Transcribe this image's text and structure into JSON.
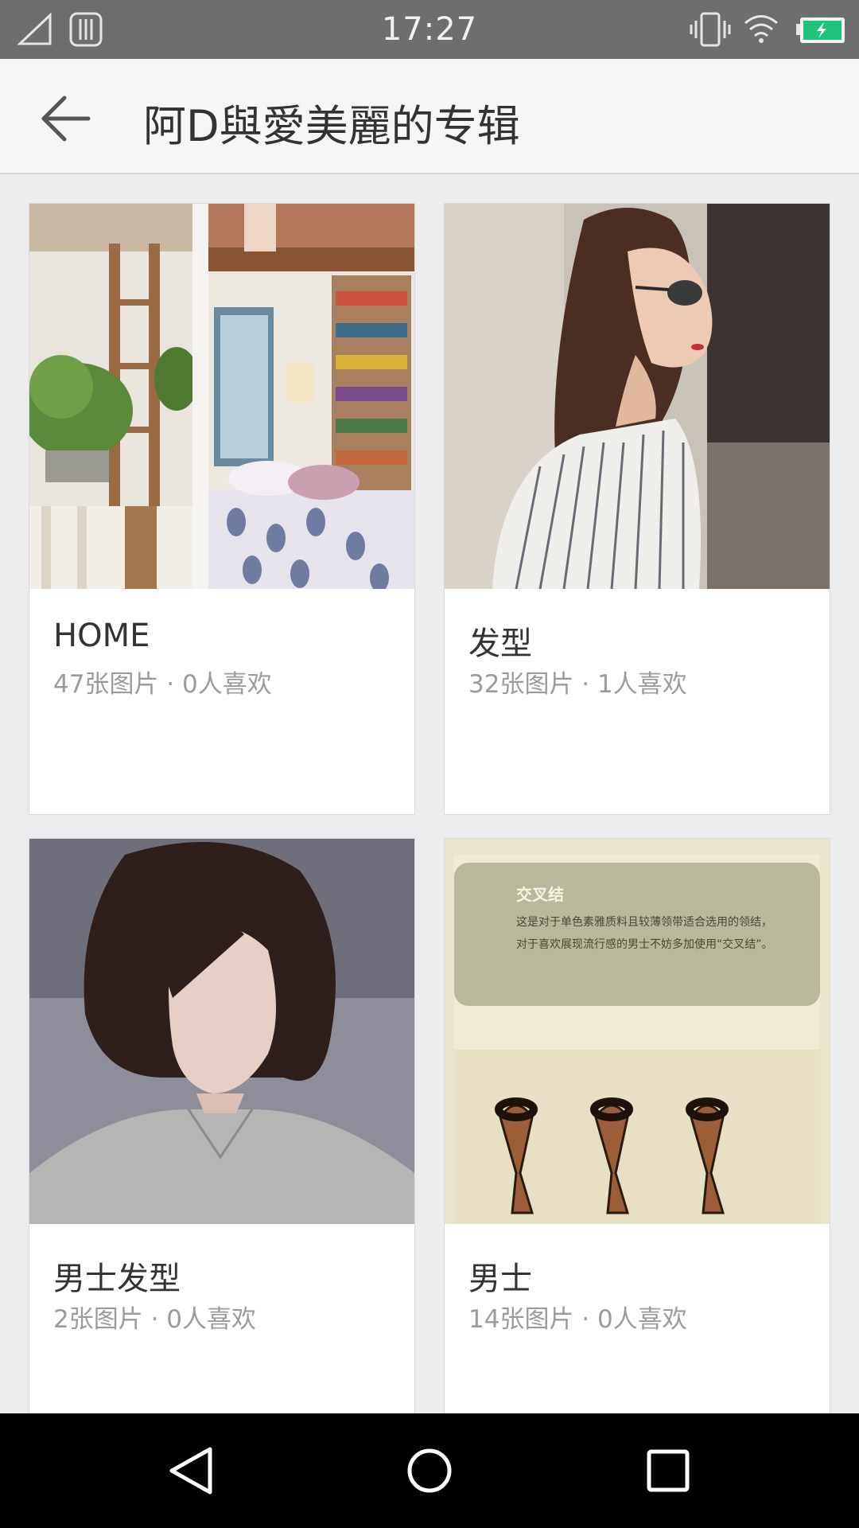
{
  "status_bar": {
    "time": "17:27",
    "icons": [
      "signal-icon",
      "sim-icon",
      "vibrate-icon",
      "wifi-icon",
      "battery-charging-icon"
    ],
    "battery_color": "#1ec27a"
  },
  "app_bar": {
    "back_icon": "arrow-left-icon",
    "title": "阿D與愛美麗的专辑"
  },
  "albums": [
    {
      "title": "HOME",
      "meta": "47张图片 · 0人喜欢",
      "image": "loft bedroom with plants"
    },
    {
      "title": "发型",
      "meta": "32张图片 · 1人喜欢",
      "image": "woman in sunglasses and striped blazer"
    },
    {
      "title": "男士发型",
      "meta": "2张图片 · 0人喜欢",
      "image": "man with long wavy hair"
    },
    {
      "title": "男士",
      "meta": "14张图片 · 0人喜欢",
      "image": "tie knot diagram",
      "image_text": {
        "heading": "交叉结",
        "line1": "这是对于单色素雅质料且较薄领带适合选用的领结，",
        "line2": "对于喜欢展现流行感的男士不妨多加使用“交叉结”。"
      }
    }
  ],
  "nav_bar": {
    "icons": [
      "back-triangle-icon",
      "home-circle-icon",
      "recents-square-icon"
    ]
  }
}
